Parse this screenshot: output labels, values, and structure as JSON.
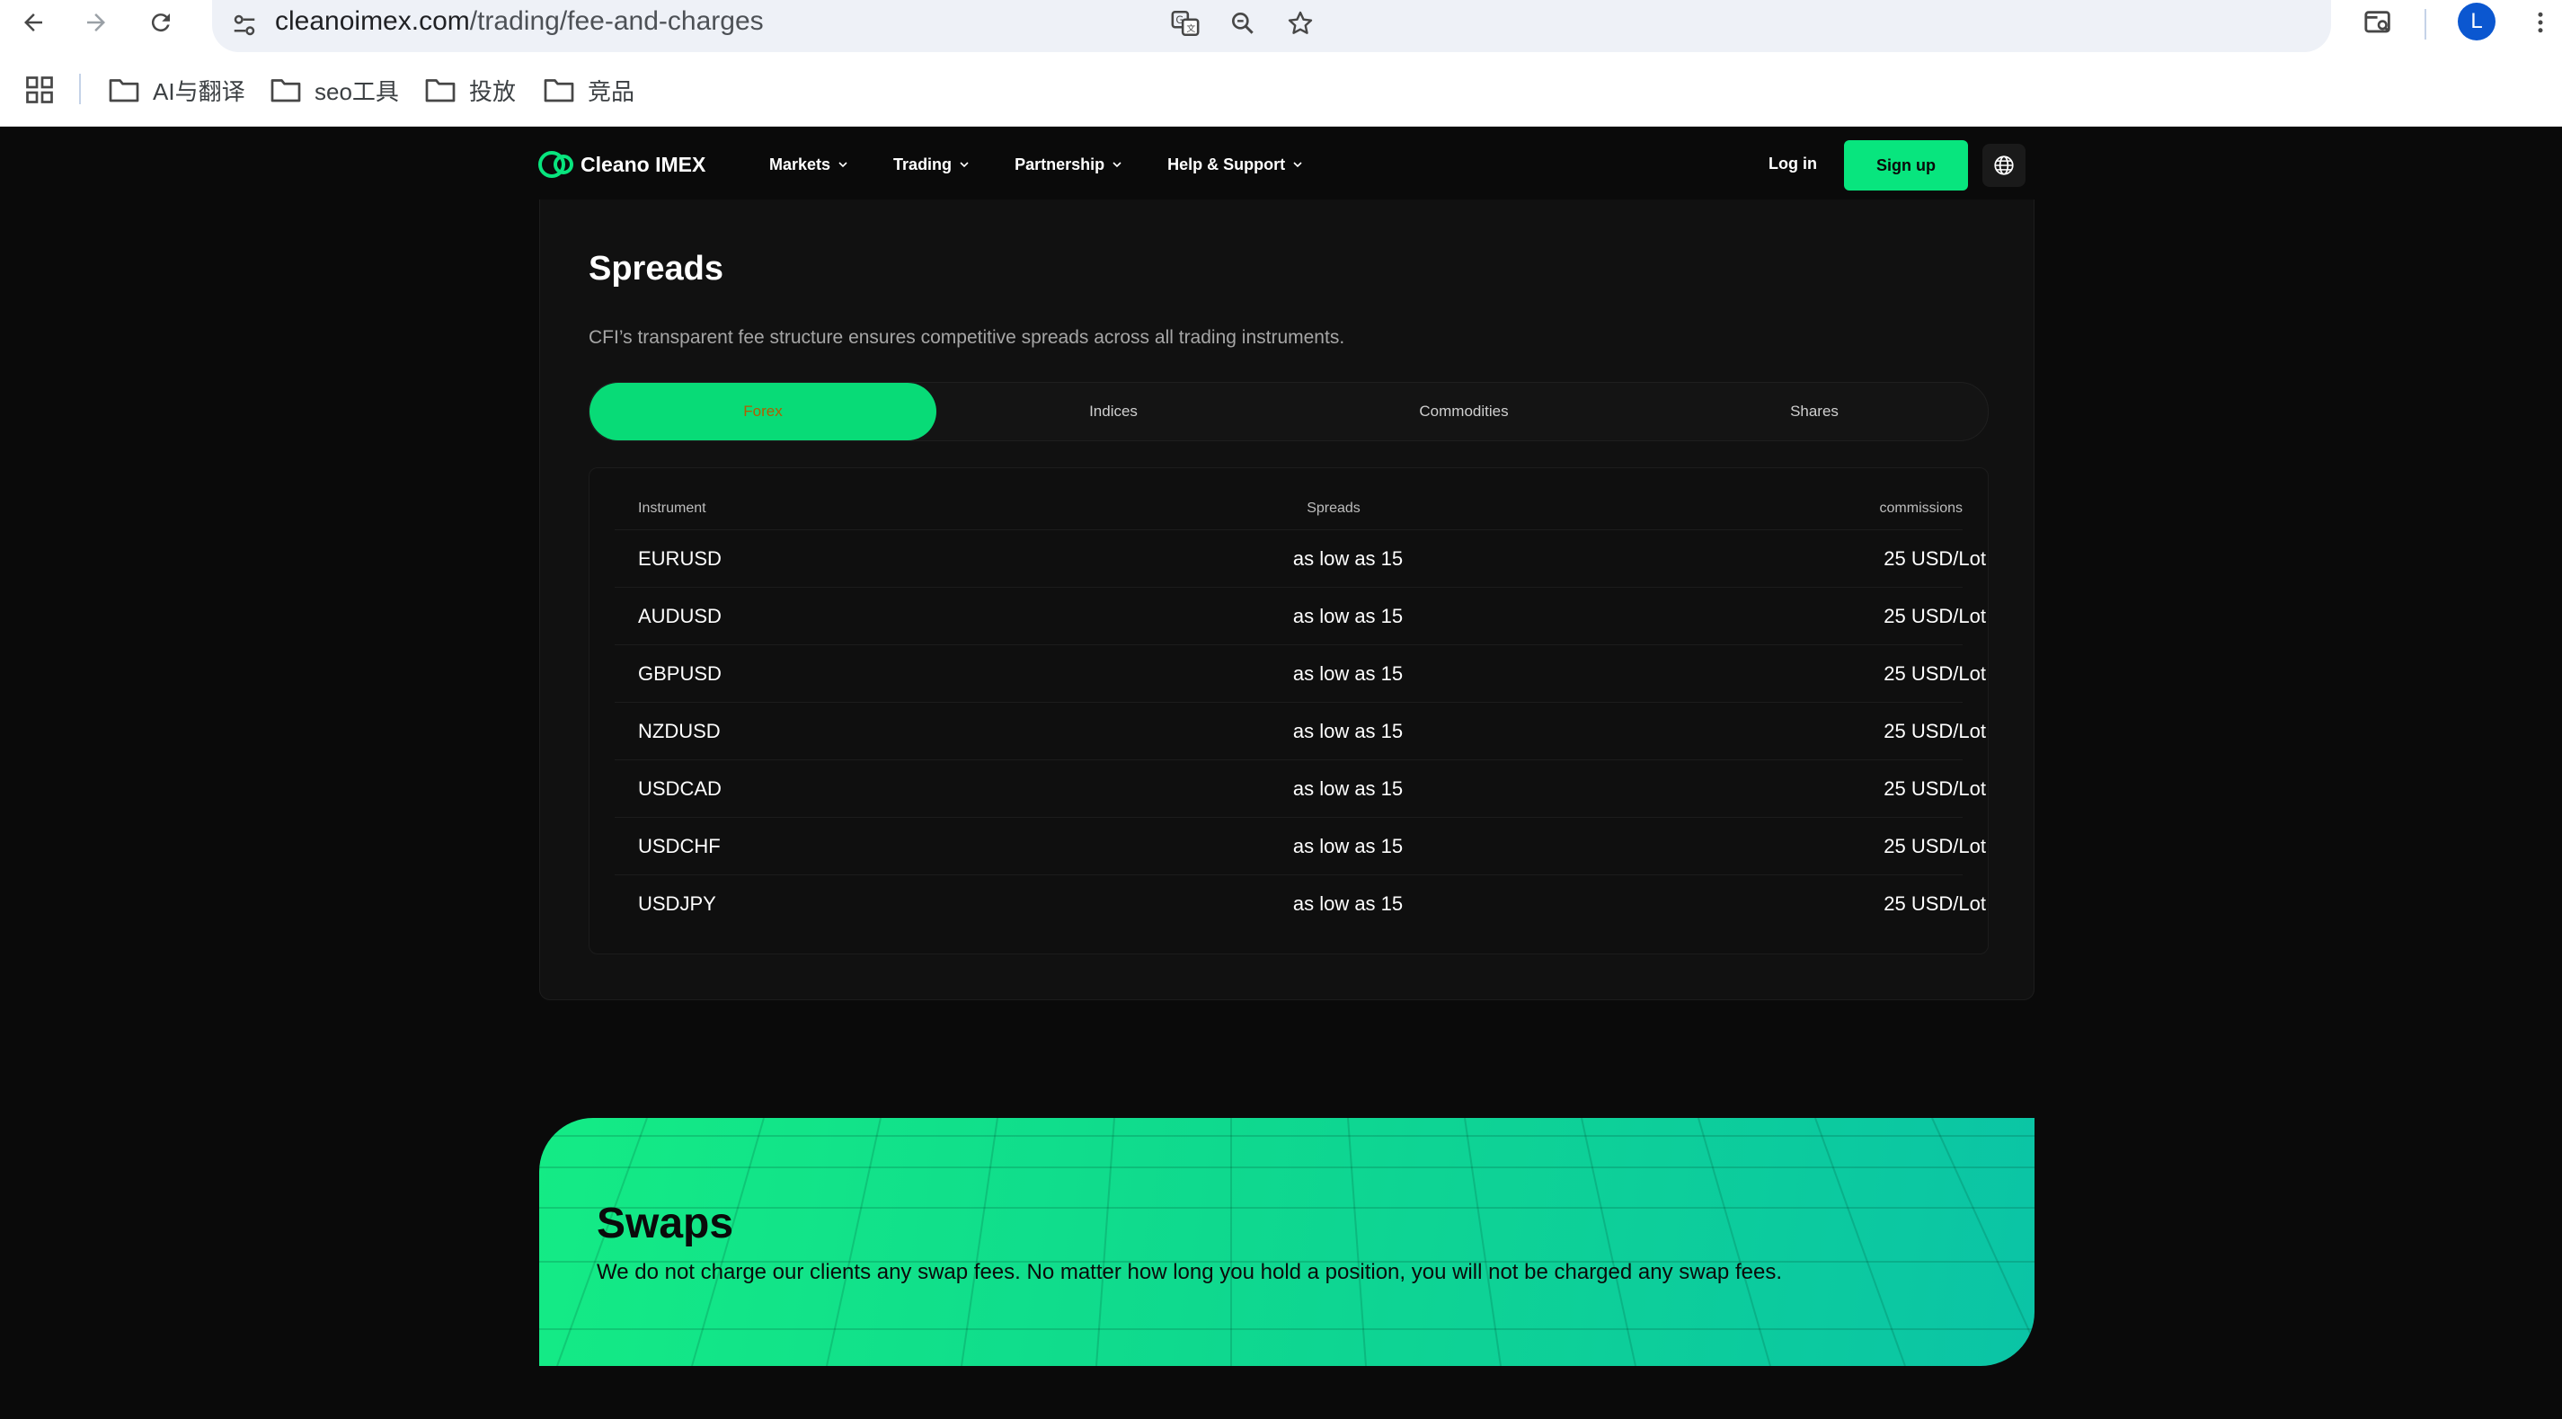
{
  "browser": {
    "url_host": "cleanoimex.com",
    "url_path": "/trading/fee-and-charges",
    "avatar_letter": "L",
    "bookmarks": [
      {
        "label": "AI与翻译"
      },
      {
        "label": "seo工具"
      },
      {
        "label": "投放"
      },
      {
        "label": "竞品"
      }
    ]
  },
  "site": {
    "brand": "Cleano IMEX",
    "brand_color": "#08e57e",
    "menu": [
      {
        "label": "Markets"
      },
      {
        "label": "Trading"
      },
      {
        "label": "Partnership"
      },
      {
        "label": "Help & Support"
      }
    ],
    "login_label": "Log in",
    "signup_label": "Sign up"
  },
  "spreads": {
    "title": "Spreads",
    "subtitle": "CFI’s transparent fee structure ensures competitive spreads across all trading instruments.",
    "tabs": [
      {
        "label": "Forex",
        "active": true
      },
      {
        "label": "Indices",
        "active": false
      },
      {
        "label": "Commodities",
        "active": false
      },
      {
        "label": "Shares",
        "active": false
      }
    ],
    "columns": [
      "Instrument",
      "Spreads",
      "commissions"
    ],
    "rows": [
      {
        "instrument": "EURUSD",
        "spread": "as low as 15",
        "commission": "25 USD/Lot"
      },
      {
        "instrument": "AUDUSD",
        "spread": "as low as 15",
        "commission": "25 USD/Lot"
      },
      {
        "instrument": "GBPUSD",
        "spread": "as low as 15",
        "commission": "25 USD/Lot"
      },
      {
        "instrument": "NZDUSD",
        "spread": "as low as 15",
        "commission": "25 USD/Lot"
      },
      {
        "instrument": "USDCAD",
        "spread": "as low as 15",
        "commission": "25 USD/Lot"
      },
      {
        "instrument": "USDCHF",
        "spread": "as low as 15",
        "commission": "25 USD/Lot"
      },
      {
        "instrument": "USDJPY",
        "spread": "as low as 15",
        "commission": "25 USD/Lot"
      }
    ]
  },
  "swaps": {
    "title": "Swaps",
    "text": "We do not charge our clients any swap fees. No matter how long you hold a position, you will not be charged any swap fees."
  }
}
